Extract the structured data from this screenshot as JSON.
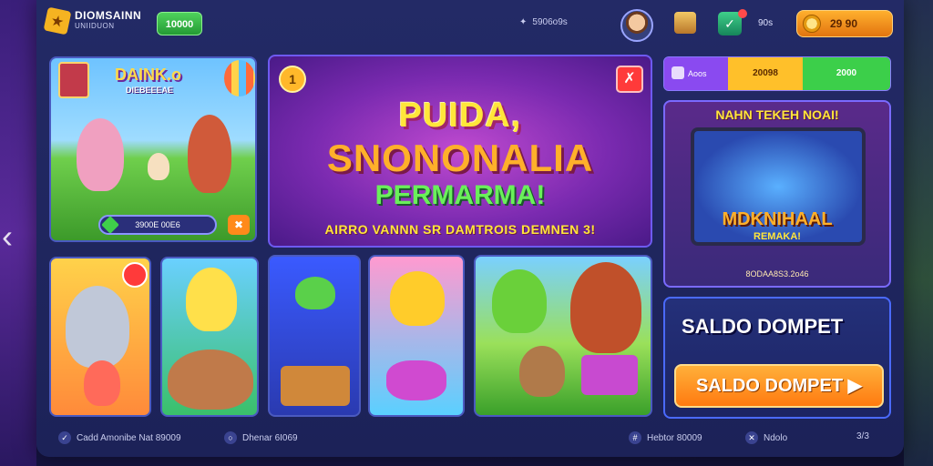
{
  "brand": {
    "title": "DIOMSAINN",
    "subtitle": "UNIIDUON"
  },
  "header": {
    "green_pill": "10000",
    "search_label": "5906o9s",
    "count_label": "90s",
    "coin_balance": "29 90"
  },
  "hero": {
    "title": "DAINK.o",
    "subtitle": "DIEBEEEAE",
    "bar_label": "3900E 00E6"
  },
  "banner": {
    "line1": "PUIDA,",
    "line2": "SNONONALIA",
    "line3": "PERMARMA!",
    "line4": "AIRRO VANNN SR DAMTROIS DEMNEN 3!"
  },
  "promo": {
    "seg1": "Aoos",
    "seg2": "20098",
    "seg3": "2000"
  },
  "tv": {
    "title": "NAHN TEKEH NOAI!",
    "headline": "MDKNIHAAL",
    "sub": "REMAKA!",
    "footer": "8ODAA8S3.2o46"
  },
  "wallet": {
    "title": "SALDO DOMPET",
    "button": "SALDO DOMPET ▶"
  },
  "footer": {
    "item1": "Cadd Amonibe Nat 89009",
    "item2": "Dhenar 6I069",
    "item3": "Hebtor 80009",
    "item4": "Ndolo",
    "item5": "3/3"
  },
  "colors": {
    "accent": "#ff8a1a",
    "panel": "#232a66",
    "gold": "#ffe63a"
  }
}
